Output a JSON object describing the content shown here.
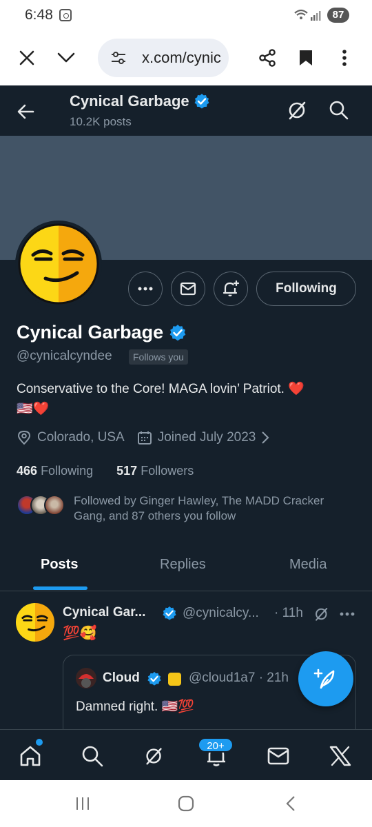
{
  "status_bar": {
    "time": "6:48",
    "battery": "87"
  },
  "browser": {
    "url": "x.com/cynic"
  },
  "header": {
    "name": "Cynical Garbage",
    "posts": "10.2K posts"
  },
  "profile": {
    "name": "Cynical Garbage",
    "handle": "@cynicalcyndee",
    "follows_you": "Follows you",
    "bio_line1": "Conservative to the Core! MAGA lovin’ Patriot.",
    "bio_line1_emoji": "❤️",
    "bio_line2_emoji": "🇺🇸❤️",
    "location": "Colorado, USA",
    "joined": "Joined July 2023",
    "following_count": "466",
    "following_label": "Following",
    "followers_count": "517",
    "followers_label": "Followers",
    "followed_by": "Followed by Ginger Hawley, The MADD Cracker Gang, and 87 others you follow",
    "following_button": "Following"
  },
  "tabs": [
    {
      "label": "Posts"
    },
    {
      "label": "Replies"
    },
    {
      "label": "Media"
    }
  ],
  "tweet": {
    "name": "Cynical Gar...",
    "handle": "@cynicalcy...",
    "time": "· 11h",
    "text": "💯🥰",
    "quote": {
      "name": "Cloud",
      "handle": "@cloud1a7 · 21h",
      "text": "Damned right.",
      "text_emoji": "🇺🇸💯"
    }
  },
  "bottom_nav": {
    "notifications_badge": "20+"
  },
  "colors": {
    "accent": "#1d9bf0",
    "background": "#15202b",
    "banner": "#425466"
  }
}
